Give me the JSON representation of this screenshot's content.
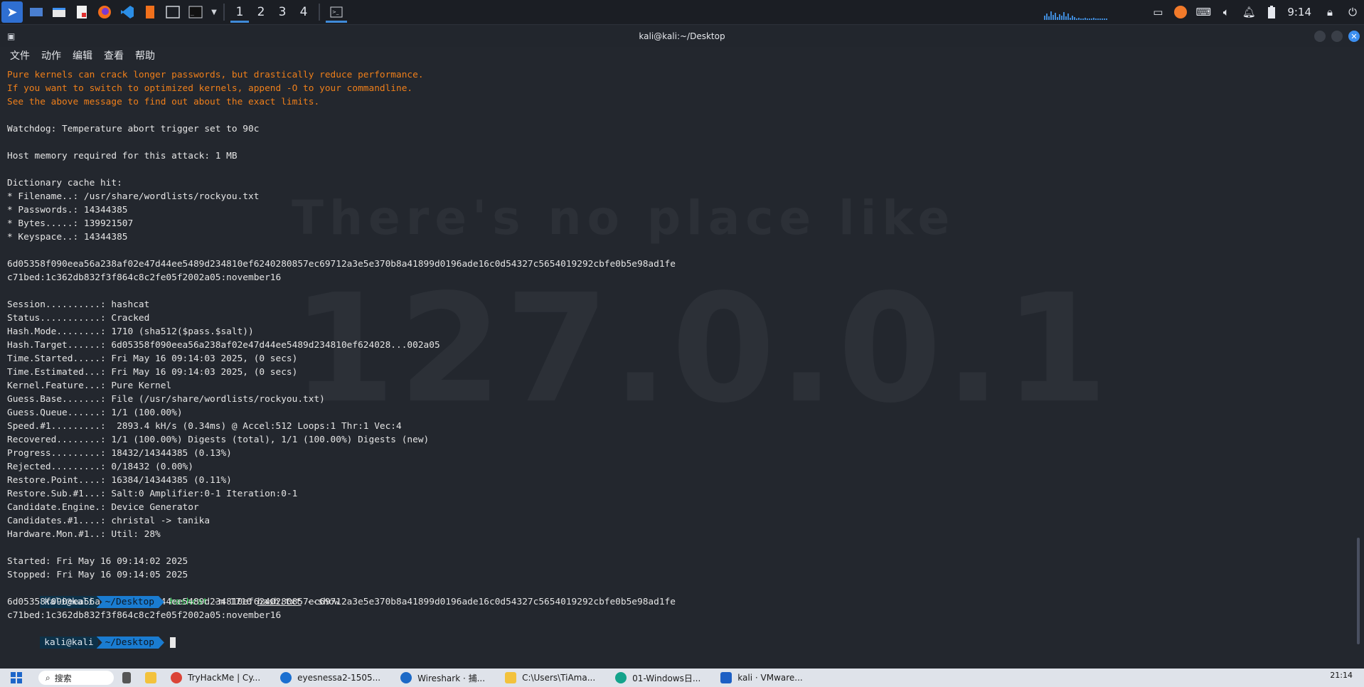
{
  "panel": {
    "workspaces": [
      "1",
      "2",
      "3",
      "4"
    ],
    "clock": "9:14"
  },
  "window": {
    "title": "kali@kali:~/Desktop",
    "menu": [
      "文件",
      "动作",
      "编辑",
      "查看",
      "帮助"
    ]
  },
  "background_text": {
    "line1": "There's no place like",
    "line2": "127.0.0.1"
  },
  "terminal": {
    "warn": [
      "Pure kernels can crack longer passwords, but drastically reduce performance.",
      "If you want to switch to optimized kernels, append -O to your commandline.",
      "See the above message to find out about the exact limits."
    ],
    "watchdog": "Watchdog: Temperature abort trigger set to 90c",
    "hostmem": "Host memory required for this attack: 1 MB",
    "dict": [
      "Dictionary cache hit:",
      "* Filename..: /usr/share/wordlists/rockyou.txt",
      "* Passwords.: 14344385",
      "* Bytes.....: 139921507",
      "* Keyspace..: 14344385"
    ],
    "hash_line1": "6d05358f090eea56a238af02e47d44ee5489d234810ef6240280857ec69712a3e5e370b8a41899d0196ade16c0d54327c5654019292cbfe0b5e98ad1fe",
    "hash_line2": "c71bed:1c362db832f3f864c8c2fe05f2002a05:november16",
    "status": [
      "Session..........: hashcat",
      "Status...........: Cracked",
      "Hash.Mode........: 1710 (sha512($pass.$salt))",
      "Hash.Target......: 6d05358f090eea56a238af02e47d44ee5489d234810ef624028...002a05",
      "Time.Started.....: Fri May 16 09:14:03 2025, (0 secs)",
      "Time.Estimated...: Fri May 16 09:14:03 2025, (0 secs)",
      "Kernel.Feature...: Pure Kernel",
      "Guess.Base.......: File (/usr/share/wordlists/rockyou.txt)",
      "Guess.Queue......: 1/1 (100.00%)",
      "Speed.#1.........:  2893.4 kH/s (0.34ms) @ Accel:512 Loops:1 Thr:1 Vec:4",
      "Recovered........: 1/1 (100.00%) Digests (total), 1/1 (100.00%) Digests (new)",
      "Progress.........: 18432/14344385 (0.13%)",
      "Rejected.........: 0/18432 (0.00%)",
      "Restore.Point....: 16384/14344385 (0.11%)",
      "Restore.Sub.#1...: Salt:0 Amplifier:0-1 Iteration:0-1",
      "Candidate.Engine.: Device Generator",
      "Candidates.#1....: christal -> tanika",
      "Hardware.Mon.#1..: Util: 28%"
    ],
    "started": "Started: Fri May 16 09:14:02 2025",
    "stopped": "Stopped: Fri May 16 09:14:05 2025",
    "prompt_user": "kali@kali",
    "prompt_dir": "~/Desktop",
    "cmd_name": "hashcat",
    "cmd_args1": " -m 1710 ",
    "cmd_file": "hash.txt",
    "cmd_args2": " --show"
  },
  "taskbar": {
    "search": "搜索",
    "items": [
      "TryHackMe | Cy...",
      "eyesnessa2-1505...",
      "Wireshark · 捕...",
      "C:\\Users\\TiAma...",
      "01-Windows日...",
      "kali · VMware..."
    ],
    "time": "21:14"
  }
}
